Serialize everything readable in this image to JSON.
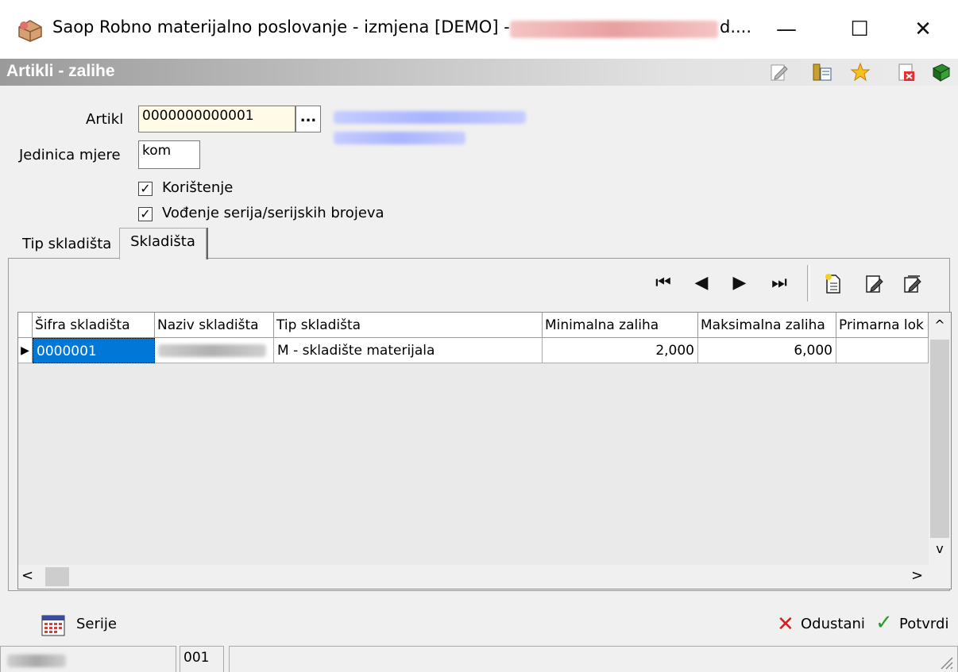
{
  "window": {
    "title": "Saop Robno materijalno poslovanje - izmjena  [DEMO] -",
    "title_suffix": "d....",
    "controls": {
      "minimize": "—",
      "maximize": "☐",
      "close": "✕"
    }
  },
  "section": {
    "title": "Artikli - zalihe"
  },
  "form": {
    "artikl_label": "Artikl",
    "artikl_value": "0000000000001",
    "browse_label": "...",
    "jedinica_label": "Jedinica mjere",
    "jedinica_value": "kom",
    "koristenje_label": "Korištenje",
    "serije_label": "Vođenje serija/serijskih brojeva",
    "checkmark": "✓"
  },
  "tabs": [
    {
      "label": "Tip skladišta",
      "active": false
    },
    {
      "label": "Skladišta",
      "active": true
    }
  ],
  "nav_toolbar": {
    "first": "⏮",
    "prev": "◀",
    "next": "▶",
    "last": "⏭"
  },
  "grid": {
    "columns": [
      "Šifra skladišta",
      "Naziv skladišta",
      "Tip skladišta",
      "Minimalna zaliha",
      "Maksimalna zaliha",
      "Primarna lok"
    ],
    "rows": [
      {
        "sifra": "0000001",
        "tip": "M - skladište materijala",
        "min": "2,000",
        "max": "6,000",
        "primarna": ""
      }
    ],
    "row_indicator": "▶",
    "scroll_up": "^",
    "scroll_down": "v",
    "scroll_left": "<",
    "scroll_right": ">"
  },
  "footer": {
    "serije_button": "Serije",
    "odustani_button": "Odustani",
    "potvrdi_button": "Potvrdi",
    "cancel_glyph": "✕",
    "confirm_glyph": "✓"
  },
  "status": {
    "code": "001"
  },
  "colors": {
    "selection": "#0078d7",
    "cancel_red": "#d32020",
    "confirm_green": "#2a9a2a"
  }
}
